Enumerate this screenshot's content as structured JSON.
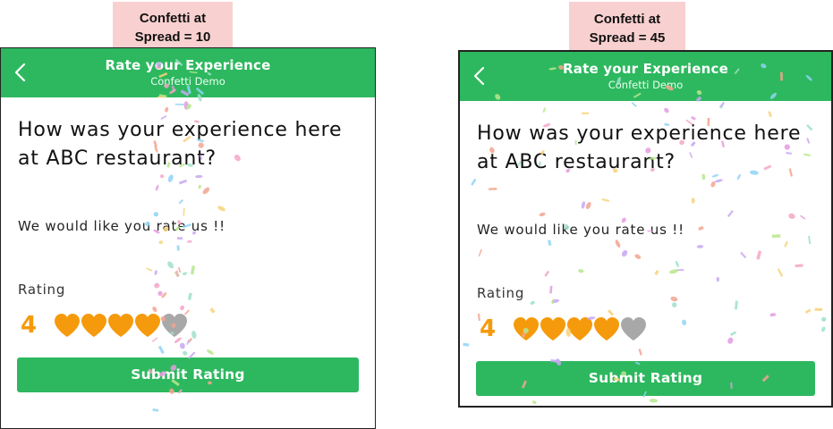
{
  "panels": [
    {
      "caption_line1": "Confetti at",
      "caption_line2": "Spread = 10",
      "app": {
        "title": "Rate your Experience",
        "subtitle": "Confetti Demo",
        "question": "How was your experience here at ABC restaurant?",
        "prompt": "We would like you rate us !!",
        "rating_label": "Rating",
        "rating_value": "4",
        "rating": 4,
        "rating_max": 5,
        "submit_label": "Submit Rating"
      },
      "confetti_spread": 10
    },
    {
      "caption_line1": "Confetti at",
      "caption_line2": "Spread = 45",
      "app": {
        "title": "Rate your Experience",
        "subtitle": "Confetti Demo",
        "question": "How was your experience here at ABC restaurant?",
        "prompt": "We would like you rate us !!",
        "rating_label": "Rating",
        "rating_value": "4",
        "rating": 4,
        "rating_max": 5,
        "submit_label": "Submit Rating"
      },
      "confetti_spread": 45
    }
  ],
  "colors": {
    "app_bar": "#2db85f",
    "heart_filled": "#f59a0c",
    "heart_empty": "#a8a8a8",
    "caption_bg": "#f9d0d0",
    "confetti": [
      "#f4a6c8",
      "#8fd3f4",
      "#c7a7f2",
      "#b7e68c",
      "#f7d27a",
      "#f3a58f",
      "#9fe0c9",
      "#e59adf"
    ]
  }
}
